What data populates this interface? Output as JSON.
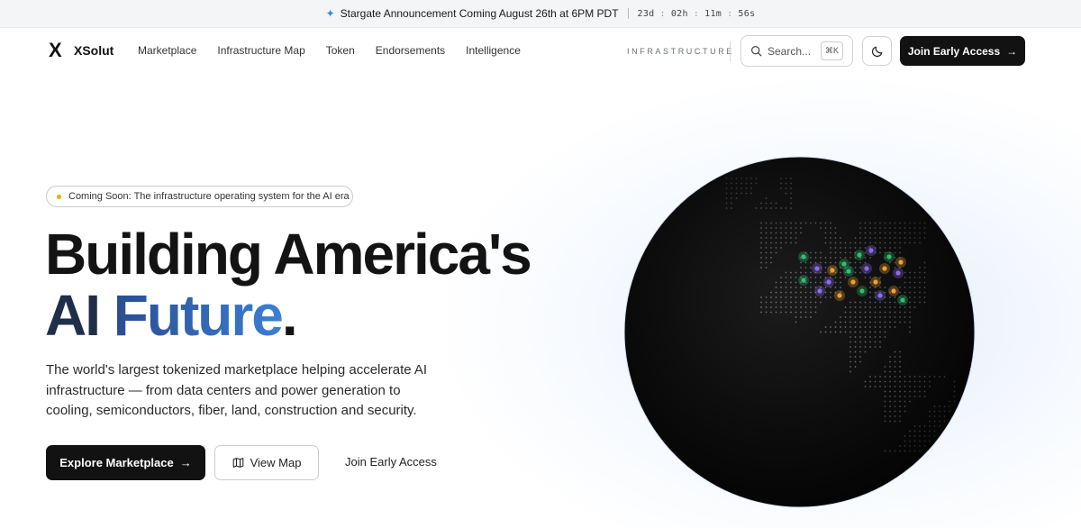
{
  "announcement": {
    "text": "Stargate Announcement Coming August 26th at 6PM PDT",
    "countdown": {
      "days": "23d",
      "hours": "02h",
      "minutes": "11m",
      "seconds": "56s"
    }
  },
  "nav": {
    "brand": "XSolut",
    "brand_mark": "X",
    "items": [
      "Marketplace",
      "Infrastructure Map",
      "Token",
      "Endorsements",
      "Intelligence"
    ],
    "section_tag": "INFRASTRUCTURE",
    "search": {
      "placeholder": "Search...",
      "shortcut": "⌘K"
    },
    "join_label": "Join Early Access"
  },
  "hero": {
    "badge": "Coming Soon: The infrastructure operating system for the AI era",
    "headline_line1": "Building America's",
    "headline_ai": "AI",
    "headline_future": "Future",
    "headline_period": ".",
    "subtext": "The world's largest tokenized marketplace helping accelerate AI infrastructure — from data centers and power generation to cooling, semiconductors, fiber, land, construction and security.",
    "cta_primary": "Explore Marketplace",
    "cta_secondary": "View Map",
    "cta_link": "Join Early Access"
  },
  "colors": {
    "accent_blue": "#3b7fd6",
    "marker_green": "#2fbf71",
    "marker_purple": "#8b6cf0",
    "marker_orange": "#f0a030"
  }
}
